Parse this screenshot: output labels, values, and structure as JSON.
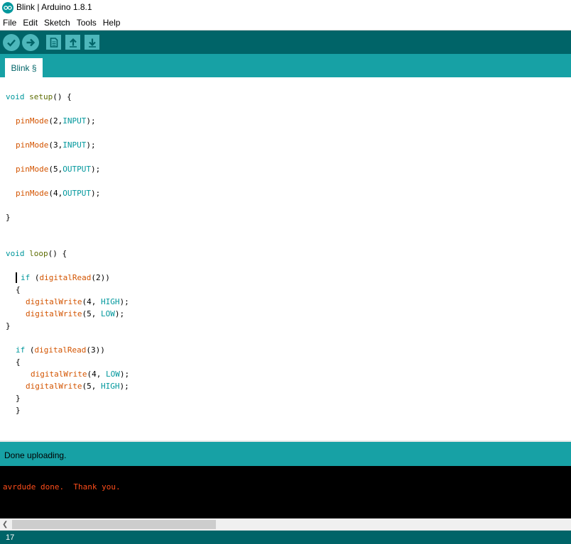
{
  "window": {
    "title": "Blink | Arduino 1.8.1"
  },
  "menu": [
    "File",
    "Edit",
    "Sketch",
    "Tools",
    "Help"
  ],
  "toolbar": {
    "buttons": [
      {
        "name": "verify-button",
        "icon": "check-icon"
      },
      {
        "name": "upload-button",
        "icon": "arrow-right-icon"
      },
      {
        "name": "new-button",
        "icon": "new-file-icon"
      },
      {
        "name": "open-button",
        "icon": "arrow-up-icon"
      },
      {
        "name": "save-button",
        "icon": "arrow-down-icon"
      }
    ]
  },
  "tabs": [
    {
      "label": "Blink §"
    }
  ],
  "code": {
    "lines": [
      "void setup() {",
      "pinMode(2,INPUT);",
      "pinMode(3,INPUT);",
      "pinMode(5,OUTPUT);",
      "pinMode(4,OUTPUT);",
      "}",
      "void loop() {",
      "if (digitalRead(2))",
      "{",
      "digitalWrite(4, HIGH);",
      "digitalWrite(5, LOW);",
      "}",
      "if (digitalRead(3))",
      "{",
      "digitalWrite(4, LOW);",
      "digitalWrite(5, HIGH);",
      "}",
      "}"
    ]
  },
  "status": {
    "message": "Done uploading."
  },
  "console": {
    "text": "avrdude done.  Thank you."
  },
  "footer": {
    "line_number": "17"
  },
  "colors": {
    "toolbar": "#006468",
    "tabbar": "#17a1a5",
    "console_bg": "#000000",
    "console_text": "#ff4d1a"
  }
}
